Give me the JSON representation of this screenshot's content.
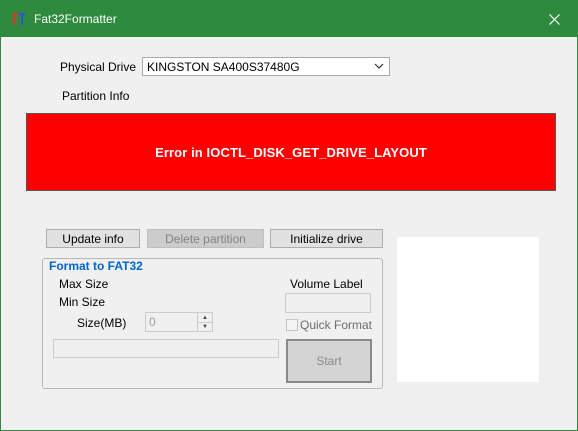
{
  "window": {
    "title": "Fat32Formatter"
  },
  "drive": {
    "label": "Physical Drive",
    "selected": "KINGSTON SA400S37480G"
  },
  "partition": {
    "label": "Partition Info",
    "error": "Error in IOCTL_DISK_GET_DRIVE_LAYOUT",
    "error_color": "#ff0000"
  },
  "buttons": {
    "update": "Update info",
    "delete": "Delete partition",
    "initialize": "Initialize drive"
  },
  "format": {
    "group_title": "Format to FAT32",
    "max_size_label": "Max Size",
    "min_size_label": "Min Size",
    "size_label": "Size(MB)",
    "size_value": "0",
    "volume_label": "Volume Label",
    "volume_value": "",
    "quick_format_label": "Quick Format",
    "quick_format_checked": false,
    "start_label": "Start",
    "progress": 0
  },
  "colors": {
    "titlebar": "#2e8b3d",
    "group_title": "#0066cc"
  }
}
